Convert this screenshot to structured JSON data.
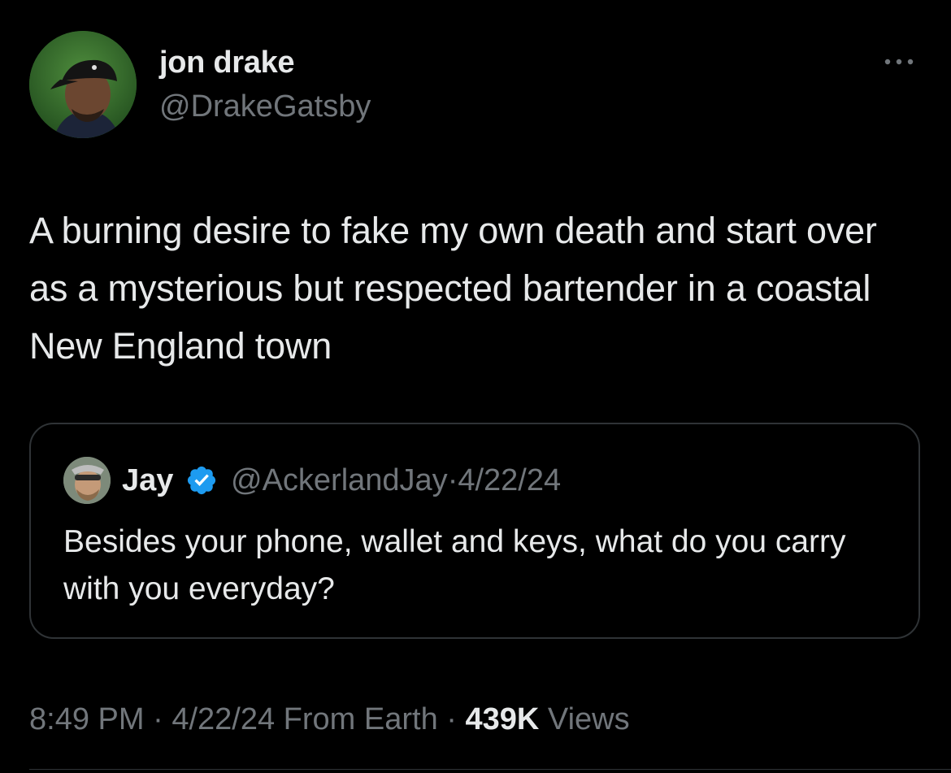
{
  "author": {
    "name": "jon drake",
    "handle": "@DrakeGatsby"
  },
  "tweet": {
    "text": "A burning desire to fake my own death and start over as a mysterious but respected bartender in a coastal New England town"
  },
  "quoted_tweet": {
    "name": "Jay",
    "handle": "@AckerlandJay",
    "separator": "·",
    "date": "4/22/24",
    "verified": true,
    "text": "Besides your phone, wallet and keys, what do you carry with you everyday?"
  },
  "footer": {
    "time": "8:49 PM",
    "separator": "·",
    "date": "4/22/24",
    "location": "From Earth",
    "views_count": "439K",
    "views_label": "Views"
  },
  "colors": {
    "background": "#000000",
    "primary_text": "#e7e9ea",
    "secondary_text": "#71767b",
    "border": "#2f3336",
    "verified_badge": "#1d9bf0"
  },
  "icons": {
    "more": "more-horizontal-icon",
    "verified": "verified-badge-icon"
  }
}
